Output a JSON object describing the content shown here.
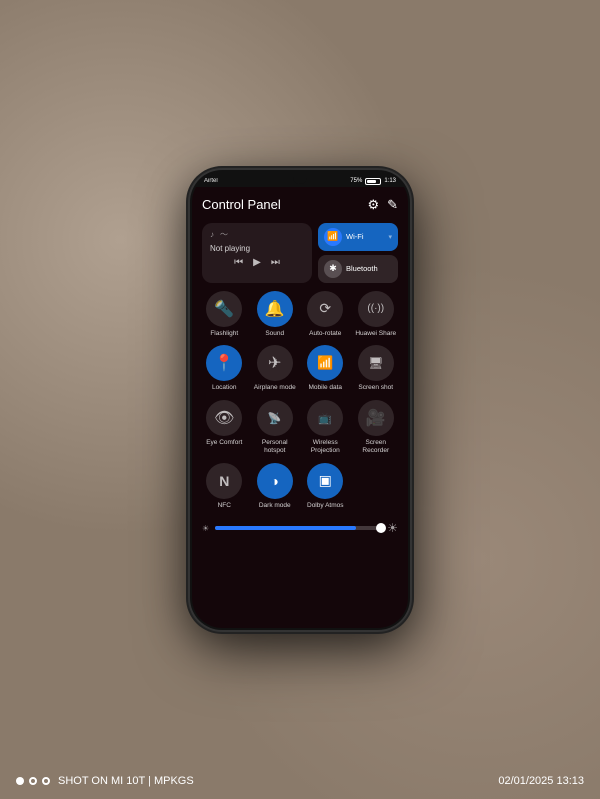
{
  "watermark": {
    "dots": [
      "filled",
      "outline",
      "outline"
    ],
    "text": "SHOT ON MI 10T | MPKGS",
    "date": "02/01/2025  13:13"
  },
  "status_bar": {
    "carrier": "Airtel",
    "battery": "75%",
    "time": "1:13"
  },
  "control_panel": {
    "title": "Control Panel",
    "settings_icon": "⚙",
    "edit_icon": "✎",
    "media": {
      "not_playing": "Not playing",
      "prev_icon": "⏮",
      "play_icon": "▶",
      "next_icon": "⏭"
    },
    "wifi": {
      "label": "Wi-Fi",
      "active": true,
      "arrow": "▾"
    },
    "bluetooth": {
      "label": "Bluetooth",
      "active": false
    },
    "tiles": [
      {
        "id": "flashlight",
        "label": "Flashlight",
        "icon": "🔦",
        "active": false
      },
      {
        "id": "sound",
        "label": "Sound",
        "icon": "🔔",
        "active": true
      },
      {
        "id": "auto-rotate",
        "label": "Auto-rotate",
        "icon": "⟳",
        "active": false
      },
      {
        "id": "huawei-share",
        "label": "Huawei Share",
        "icon": "((·))",
        "active": false
      },
      {
        "id": "location",
        "label": "Location",
        "icon": "📍",
        "active": true
      },
      {
        "id": "airplane",
        "label": "Airplane mode",
        "icon": "✈",
        "active": false
      },
      {
        "id": "mobile-data",
        "label": "Mobile data",
        "icon": "📶",
        "active": true
      },
      {
        "id": "screenshot",
        "label": "Screen shot",
        "icon": "🖥",
        "active": false
      },
      {
        "id": "eye-comfort",
        "label": "Eye Comfort",
        "icon": "👁",
        "active": false
      },
      {
        "id": "personal-hotspot",
        "label": "Personal hotspot",
        "icon": "📡",
        "active": false
      },
      {
        "id": "wireless-projection",
        "label": "Wireless Projection",
        "icon": "📺",
        "active": false
      },
      {
        "id": "screen-recorder",
        "label": "Screen Recorder",
        "icon": "🎥",
        "active": false
      },
      {
        "id": "nfc",
        "label": "NFC",
        "icon": "N",
        "active": false
      },
      {
        "id": "dark-mode",
        "label": "Dark mode",
        "icon": "◑",
        "active": true
      },
      {
        "id": "dolby-atmos",
        "label": "Dolby Atmos",
        "icon": "▣",
        "active": true
      }
    ],
    "brightness": {
      "min_icon": "☀",
      "max_icon": "☀",
      "value": 85
    }
  }
}
